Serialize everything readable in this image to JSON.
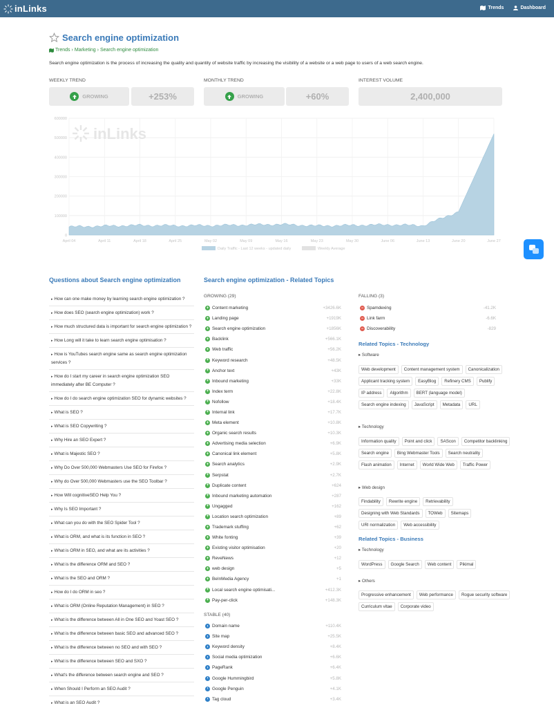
{
  "app": {
    "logo_text": "inLinks",
    "nav": [
      {
        "label": "Trends",
        "icon": "map-icon"
      },
      {
        "label": "Dashboard",
        "icon": "user-icon"
      }
    ]
  },
  "header": {
    "title": "Search engine optimization",
    "breadcrumb": [
      "Trends",
      "Marketing",
      "Search engine optimization"
    ],
    "description": "Search engine optimization is the process of increasing the quality and quantity of website traffic by increasing the visibility of a website or a web page to users of a web search engine."
  },
  "metrics": {
    "weekly": {
      "label": "WEEKLY TREND",
      "status": "GROWING",
      "change": "+253%"
    },
    "monthly": {
      "label": "MONTHLY TREND",
      "status": "GROWING",
      "change": "+60%"
    },
    "volume": {
      "label": "INTEREST VOLUME",
      "value": "2,400,000"
    }
  },
  "chart_data": {
    "type": "area",
    "watermark": "inLinks",
    "y_ticks": [
      "0",
      "100000",
      "200000",
      "300000",
      "400000",
      "500000",
      "600000"
    ],
    "ylim": [
      0,
      600000
    ],
    "x_ticks": [
      "April 04",
      "April 11",
      "April 18",
      "April 25",
      "May 02",
      "May 09",
      "May 16",
      "May 23",
      "May 30",
      "June 06",
      "June 13",
      "June 20",
      "June 27"
    ],
    "legend": [
      {
        "name": "Daily Traffic - Last 12 weeks - updated daily",
        "color": "#b7d3e3"
      },
      {
        "name": "Weekly Average",
        "color": "#e2e2e2"
      }
    ],
    "series": [
      {
        "name": "Daily Traffic - Last 12 weeks - updated daily",
        "x": [
          "April 04",
          "April 11",
          "April 18",
          "April 25",
          "May 02",
          "May 09",
          "May 16",
          "May 23",
          "May 30",
          "June 06",
          "June 13",
          "June 20",
          "June 27"
        ],
        "values": [
          42000,
          46000,
          50000,
          48000,
          49000,
          52000,
          55000,
          47000,
          50000,
          53000,
          49000,
          120000,
          520000
        ]
      }
    ],
    "grid": true
  },
  "questions": {
    "title": "Questions about Search engine optimization",
    "items": [
      "How can one make money by learning search engine optimization ?",
      "How does SEO (search engine optimization) work ?",
      "How much structured data is important for search engine optimization ?",
      "How Long will it take to learn search engine optimisation ?",
      "How is YouTubes search engine same as search engine optimization services ?",
      "How do I start my career in search engine optimization SEO immediately after BE Computer ?",
      "How do I do search engine optimization SEO for dynamic websites ?",
      "What is SEO ?",
      "What is SEO Copywriting ?",
      "Why Hire an SEO Expert ?",
      "What is Majestic SEO ?",
      "Why Do Over 500,000 Webmasters Use SEO for Firefox ?",
      "Why do Over 500,000 Webmasters use the SEO Toolbar ?",
      "How Will cognitiveSEO Help You ?",
      "Why Is SEO Important ?",
      "What can you do with the SEO Spider Tool ?",
      "What is ORM, and what is its function in SEO ?",
      "What is ORM in SEO, and what are its activities ?",
      "What is the difference ORM and SEO ?",
      "What is the SEO and ORM ?",
      "How do I do ORM in seo ?",
      "What is ORM (Online Reputation Management) in SEO ?",
      "What is the difference between All in One SEO and Yoast SEO ?",
      "What is the difference between basic SEO and advanced SEO ?",
      "What is the difference between no SEO and with SEO ?",
      "What is the difference between SEO and SXO ?",
      "What's the difference between search engine and SEO ?",
      "When Should I Perform an SEO Audit ?",
      "What is an SEO Audit ?"
    ]
  },
  "related": {
    "title": "Search engine optimization - Related Topics",
    "growing": {
      "label": "GROWING (29)",
      "items": [
        {
          "name": "Content marketing",
          "value": "+3426.6K"
        },
        {
          "name": "Landing page",
          "value": "+1919K"
        },
        {
          "name": "Search engine optimization",
          "value": "+1856K"
        },
        {
          "name": "Backlink",
          "value": "+566.1K"
        },
        {
          "name": "Web traffic",
          "value": "+56.2K"
        },
        {
          "name": "Keyword research",
          "value": "+48.5K"
        },
        {
          "name": "Anchor text",
          "value": "+43K"
        },
        {
          "name": "Inbound marketing",
          "value": "+33K"
        },
        {
          "name": "Index term",
          "value": "+22.8K"
        },
        {
          "name": "Nofollow",
          "value": "+18.4K"
        },
        {
          "name": "Internal link",
          "value": "+17.7K"
        },
        {
          "name": "Meta element",
          "value": "+10.8K"
        },
        {
          "name": "Organic search results",
          "value": "+10.3K"
        },
        {
          "name": "Advertising media selection",
          "value": "+6.9K"
        },
        {
          "name": "Canonical link element",
          "value": "+5.8K"
        },
        {
          "name": "Search analytics",
          "value": "+2.9K"
        },
        {
          "name": "Serpstat",
          "value": "+2.7K"
        },
        {
          "name": "Duplicate content",
          "value": "+624"
        },
        {
          "name": "Inbound marketing automation",
          "value": "+287"
        },
        {
          "name": "Ungagged",
          "value": "+162"
        },
        {
          "name": "Location search optimization",
          "value": "+89"
        },
        {
          "name": "Trademark stuffing",
          "value": "+62"
        },
        {
          "name": "White fonting",
          "value": "+39"
        },
        {
          "name": "Existing visitor optimisation",
          "value": "+20"
        },
        {
          "name": "ReveNews",
          "value": "+12"
        },
        {
          "name": "web design",
          "value": "+5"
        },
        {
          "name": "BeInMedia Agency",
          "value": "+1"
        },
        {
          "name": "Local search engine optimisati...",
          "value": "+412.3K"
        },
        {
          "name": "Pay-per-click",
          "value": "+148.3K"
        }
      ]
    },
    "stable": {
      "label": "STABLE (40)",
      "items": [
        {
          "name": "Domain name",
          "value": "+110.4K"
        },
        {
          "name": "Site map",
          "value": "+25.5K"
        },
        {
          "name": "Keyword density",
          "value": "+8.4K"
        },
        {
          "name": "Social media optimization",
          "value": "+6.6K"
        },
        {
          "name": "PageRank",
          "value": "+6.4K"
        },
        {
          "name": "Google Hummingbird",
          "value": "+5.8K"
        },
        {
          "name": "Google Penguin",
          "value": "+4.1K"
        },
        {
          "name": "Tag cloud",
          "value": "+3.4K"
        }
      ]
    },
    "falling": {
      "label": "FALLING (3)",
      "items": [
        {
          "name": "Spamdexing",
          "value": "-41.2K"
        },
        {
          "name": "Link farm",
          "value": "-6.6K"
        },
        {
          "name": "Discoverability",
          "value": "-829"
        }
      ]
    }
  },
  "tech": {
    "title": "Related Topics - Technology",
    "groups": [
      {
        "label": "Software",
        "tags": [
          "Web development",
          "Content management system",
          "Canonicalization",
          "Applicant tracking system",
          "EasyBlog",
          "Refinery CMS",
          "Publify",
          "IP address",
          "Algorithm",
          "BERT (language model)",
          "Search engine indexing",
          "JavaScript",
          "Metadata",
          "URL"
        ]
      },
      {
        "label": "Technology",
        "tags": [
          "Information quality",
          "Point and click",
          "SAScon",
          "Competitor backlinking",
          "Search engine",
          "Bing Webmaster Tools",
          "Search neutrality",
          "Flash animation",
          "Internet",
          "World Wide Web",
          "Traffic Power"
        ]
      },
      {
        "label": "Web design",
        "tags": [
          "Findability",
          "Rewrite engine",
          "Retrievability",
          "Designing with Web Standards",
          "TOWeb",
          "Sitemaps",
          "URI normalization",
          "Web accessibility"
        ]
      }
    ]
  },
  "business": {
    "title": "Related Topics - Business",
    "groups": [
      {
        "label": "Technology",
        "tags": [
          "WordPress",
          "Google Search",
          "Web content",
          "Pikimal"
        ]
      },
      {
        "label": "Others",
        "tags": [
          "Progressive enhancement",
          "Web performance",
          "Rogue security software",
          "Curriculum vitae",
          "Corporate video"
        ]
      }
    ]
  }
}
